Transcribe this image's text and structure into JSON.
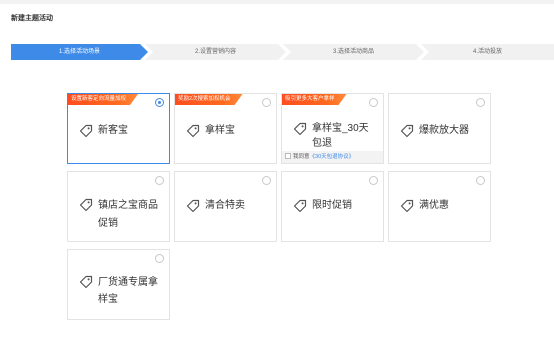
{
  "page": {
    "title": "新建主题活动"
  },
  "steps": [
    {
      "label": "1.选择活动场景",
      "active": true
    },
    {
      "label": "2.设置营销内容",
      "active": false
    },
    {
      "label": "3.选择活动商品",
      "active": false
    },
    {
      "label": "4.活动投放",
      "active": false
    }
  ],
  "colors": {
    "accent": "#3d8ae8",
    "ribbon": "#ff5a1f",
    "border": "#e3e3e3"
  },
  "icons": {
    "card_icon": "tag-icon"
  },
  "cards": [
    {
      "label": "新客宝",
      "ribbon": "设置新客定向流量加权",
      "selected": true
    },
    {
      "label": "拿样宝",
      "ribbon": "奖励2次搜索加权机会",
      "selected": false
    },
    {
      "label": "拿样宝_30天包退",
      "ribbon": "吸引更多大客户拿样",
      "selected": false,
      "agree": {
        "prefix": "我同意",
        "link": "《30天包退协议》"
      }
    },
    {
      "label": "爆款放大器",
      "selected": false
    },
    {
      "label": "镇店之宝商品促销",
      "selected": false
    },
    {
      "label": "清合特卖",
      "selected": false
    },
    {
      "label": "限时促销",
      "selected": false
    },
    {
      "label": "满优惠",
      "selected": false
    },
    {
      "label": "厂货通专属拿样宝",
      "selected": false
    }
  ]
}
